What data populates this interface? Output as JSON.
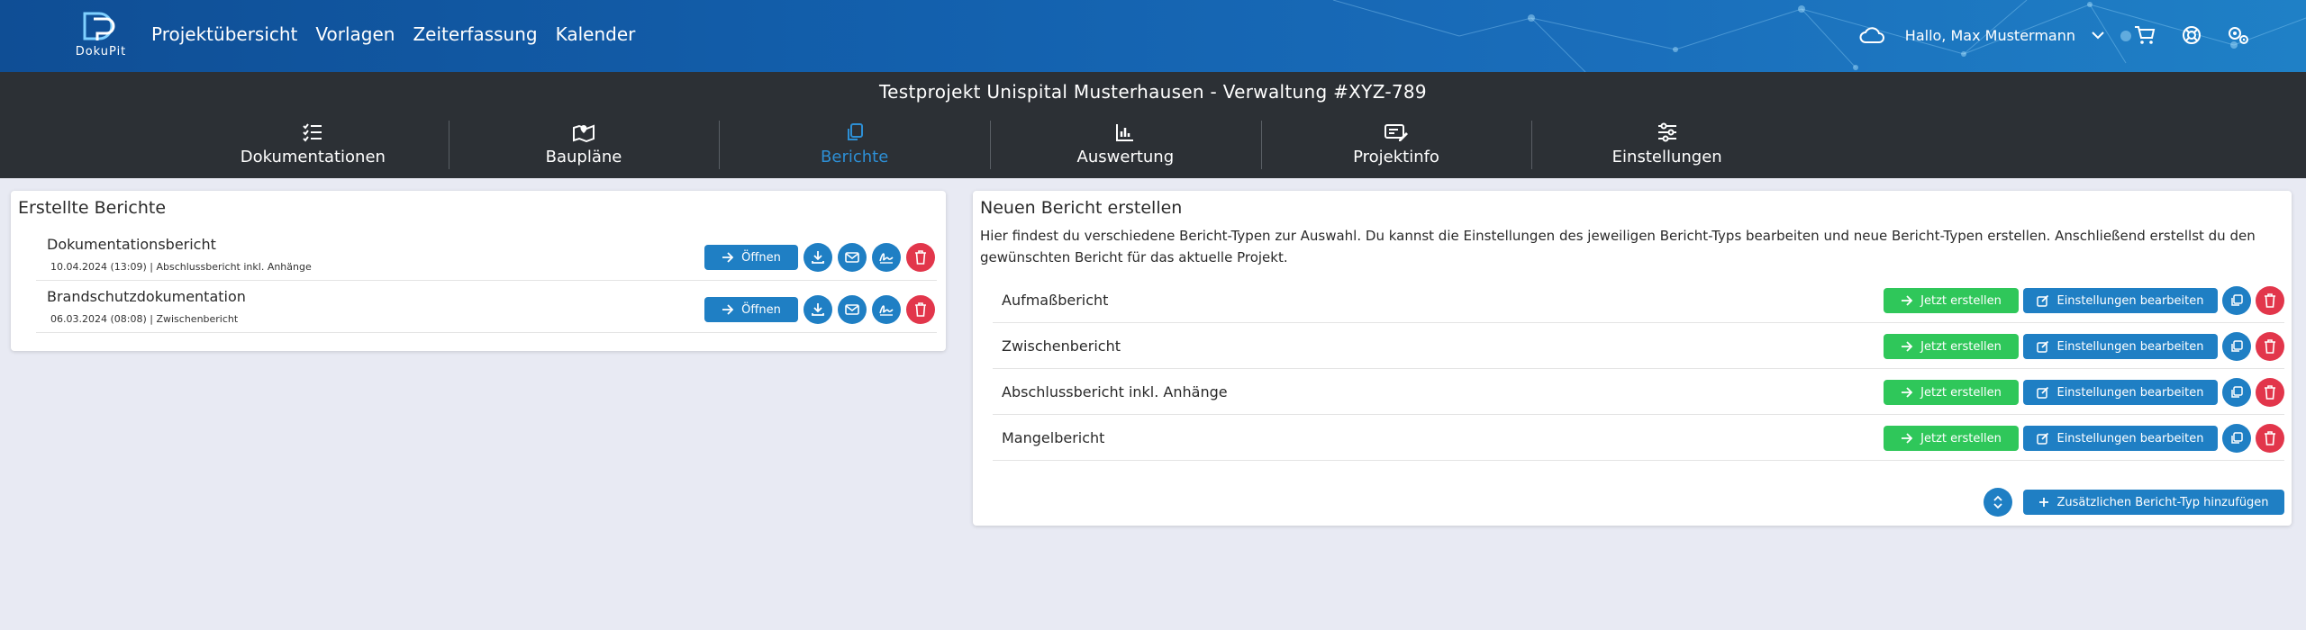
{
  "app": {
    "logo_text": "DokuPit"
  },
  "nav": {
    "items": [
      "Projektübersicht",
      "Vorlagen",
      "Zeiterfassung",
      "Kalender"
    ]
  },
  "user": {
    "greeting": "Hallo, Max Mustermann"
  },
  "project": {
    "title": "Testprojekt Unispital Musterhausen - Verwaltung",
    "id": "#XYZ-789"
  },
  "tabs": [
    {
      "label": "Dokumentationen",
      "icon": "checklist-icon"
    },
    {
      "label": "Baupläne",
      "icon": "map-icon"
    },
    {
      "label": "Berichte",
      "icon": "copy-icon",
      "active": true
    },
    {
      "label": "Auswertung",
      "icon": "bar-chart-icon"
    },
    {
      "label": "Projektinfo",
      "icon": "edit-note-icon"
    },
    {
      "label": "Einstellungen",
      "icon": "sliders-icon"
    }
  ],
  "created_reports": {
    "title": "Erstellte Berichte",
    "open_label": "Öffnen",
    "items": [
      {
        "name": "Dokumentationsbericht",
        "meta": "10.04.2024 (13:09) | Abschlussbericht inkl. Anhänge"
      },
      {
        "name": "Brandschutzdokumentation",
        "meta": "06.03.2024 (08:08) | Zwischenbericht"
      }
    ]
  },
  "new_report": {
    "title": "Neuen Bericht erstellen",
    "description": "Hier findest du verschiedene Bericht-Typen zur Auswahl. Du kannst die Einstellungen des jeweiligen Bericht-Typs bearbeiten und neue Bericht-Typen erstellen. Anschließend erstellst du den gewünschten Bericht für das aktuelle Projekt.",
    "create_label": "Jetzt erstellen",
    "edit_label": "Einstellungen bearbeiten",
    "types": [
      "Aufmaßbericht",
      "Zwischenbericht",
      "Abschlussbericht inkl. Anhänge",
      "Mangelbericht"
    ],
    "add_label": "Zusätzlichen Bericht-Typ hinzufügen"
  },
  "colors": {
    "primary": "#1f7fc4",
    "success": "#2fc75a",
    "danger": "#e2364b",
    "dark": "#2c3035",
    "active_tab": "#2d8fd5"
  }
}
